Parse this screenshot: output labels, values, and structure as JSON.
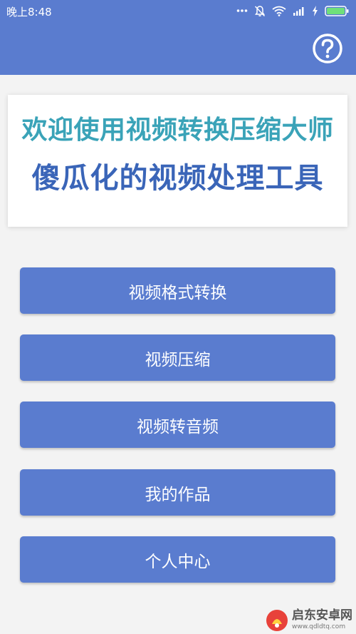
{
  "status_bar": {
    "time": "晚上8:48",
    "icons": [
      "more-dots-icon",
      "bell-muted-icon",
      "wifi-icon",
      "signal-icon",
      "charging-bolt-icon",
      "battery-icon"
    ]
  },
  "app_bar": {
    "color": "#5a7ccf",
    "help_icon": "question-circle-icon"
  },
  "banner": {
    "line1": "欢迎使用视频转换压缩大师",
    "line2": "傻瓜化的视频处理工具",
    "line1_color": "#3aa3b8",
    "line2_color": "#3a65b8"
  },
  "menu": [
    {
      "label": "视频格式转换"
    },
    {
      "label": "视频压缩"
    },
    {
      "label": "视频转音频"
    },
    {
      "label": "我的作品"
    },
    {
      "label": "个人中心"
    }
  ],
  "watermark": {
    "title": "启东安卓网",
    "url": "www.qdldtq.com"
  }
}
